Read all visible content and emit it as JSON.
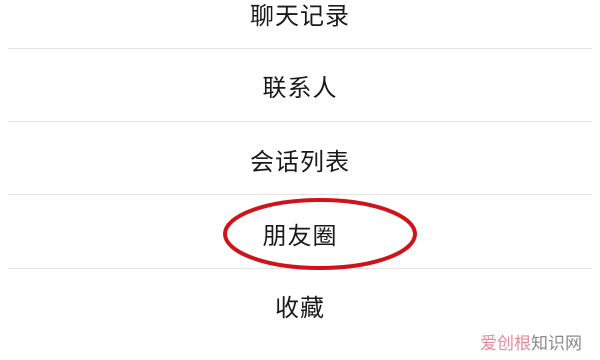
{
  "menu": {
    "items": [
      {
        "label": "聊天记录"
      },
      {
        "label": "联系人"
      },
      {
        "label": "会话列表"
      },
      {
        "label": "朋友圈"
      },
      {
        "label": "收藏"
      }
    ]
  },
  "highlight": {
    "target": "朋友圈",
    "color": "#d0121b"
  },
  "watermark": {
    "brand": "爱创根",
    "rest": "知识网"
  }
}
